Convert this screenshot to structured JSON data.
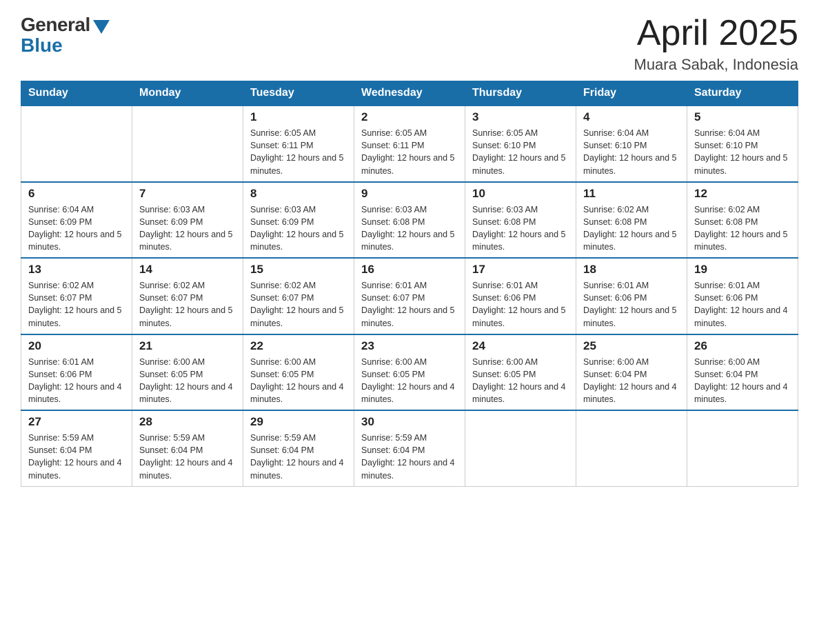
{
  "header": {
    "logo_general": "General",
    "logo_blue": "Blue",
    "title": "April 2025",
    "subtitle": "Muara Sabak, Indonesia"
  },
  "days_of_week": [
    "Sunday",
    "Monday",
    "Tuesday",
    "Wednesday",
    "Thursday",
    "Friday",
    "Saturday"
  ],
  "weeks": [
    [
      {
        "day": "",
        "info": ""
      },
      {
        "day": "",
        "info": ""
      },
      {
        "day": "1",
        "info": "Sunrise: 6:05 AM\nSunset: 6:11 PM\nDaylight: 12 hours and 5 minutes."
      },
      {
        "day": "2",
        "info": "Sunrise: 6:05 AM\nSunset: 6:11 PM\nDaylight: 12 hours and 5 minutes."
      },
      {
        "day": "3",
        "info": "Sunrise: 6:05 AM\nSunset: 6:10 PM\nDaylight: 12 hours and 5 minutes."
      },
      {
        "day": "4",
        "info": "Sunrise: 6:04 AM\nSunset: 6:10 PM\nDaylight: 12 hours and 5 minutes."
      },
      {
        "day": "5",
        "info": "Sunrise: 6:04 AM\nSunset: 6:10 PM\nDaylight: 12 hours and 5 minutes."
      }
    ],
    [
      {
        "day": "6",
        "info": "Sunrise: 6:04 AM\nSunset: 6:09 PM\nDaylight: 12 hours and 5 minutes."
      },
      {
        "day": "7",
        "info": "Sunrise: 6:03 AM\nSunset: 6:09 PM\nDaylight: 12 hours and 5 minutes."
      },
      {
        "day": "8",
        "info": "Sunrise: 6:03 AM\nSunset: 6:09 PM\nDaylight: 12 hours and 5 minutes."
      },
      {
        "day": "9",
        "info": "Sunrise: 6:03 AM\nSunset: 6:08 PM\nDaylight: 12 hours and 5 minutes."
      },
      {
        "day": "10",
        "info": "Sunrise: 6:03 AM\nSunset: 6:08 PM\nDaylight: 12 hours and 5 minutes."
      },
      {
        "day": "11",
        "info": "Sunrise: 6:02 AM\nSunset: 6:08 PM\nDaylight: 12 hours and 5 minutes."
      },
      {
        "day": "12",
        "info": "Sunrise: 6:02 AM\nSunset: 6:08 PM\nDaylight: 12 hours and 5 minutes."
      }
    ],
    [
      {
        "day": "13",
        "info": "Sunrise: 6:02 AM\nSunset: 6:07 PM\nDaylight: 12 hours and 5 minutes."
      },
      {
        "day": "14",
        "info": "Sunrise: 6:02 AM\nSunset: 6:07 PM\nDaylight: 12 hours and 5 minutes."
      },
      {
        "day": "15",
        "info": "Sunrise: 6:02 AM\nSunset: 6:07 PM\nDaylight: 12 hours and 5 minutes."
      },
      {
        "day": "16",
        "info": "Sunrise: 6:01 AM\nSunset: 6:07 PM\nDaylight: 12 hours and 5 minutes."
      },
      {
        "day": "17",
        "info": "Sunrise: 6:01 AM\nSunset: 6:06 PM\nDaylight: 12 hours and 5 minutes."
      },
      {
        "day": "18",
        "info": "Sunrise: 6:01 AM\nSunset: 6:06 PM\nDaylight: 12 hours and 5 minutes."
      },
      {
        "day": "19",
        "info": "Sunrise: 6:01 AM\nSunset: 6:06 PM\nDaylight: 12 hours and 4 minutes."
      }
    ],
    [
      {
        "day": "20",
        "info": "Sunrise: 6:01 AM\nSunset: 6:06 PM\nDaylight: 12 hours and 4 minutes."
      },
      {
        "day": "21",
        "info": "Sunrise: 6:00 AM\nSunset: 6:05 PM\nDaylight: 12 hours and 4 minutes."
      },
      {
        "day": "22",
        "info": "Sunrise: 6:00 AM\nSunset: 6:05 PM\nDaylight: 12 hours and 4 minutes."
      },
      {
        "day": "23",
        "info": "Sunrise: 6:00 AM\nSunset: 6:05 PM\nDaylight: 12 hours and 4 minutes."
      },
      {
        "day": "24",
        "info": "Sunrise: 6:00 AM\nSunset: 6:05 PM\nDaylight: 12 hours and 4 minutes."
      },
      {
        "day": "25",
        "info": "Sunrise: 6:00 AM\nSunset: 6:04 PM\nDaylight: 12 hours and 4 minutes."
      },
      {
        "day": "26",
        "info": "Sunrise: 6:00 AM\nSunset: 6:04 PM\nDaylight: 12 hours and 4 minutes."
      }
    ],
    [
      {
        "day": "27",
        "info": "Sunrise: 5:59 AM\nSunset: 6:04 PM\nDaylight: 12 hours and 4 minutes."
      },
      {
        "day": "28",
        "info": "Sunrise: 5:59 AM\nSunset: 6:04 PM\nDaylight: 12 hours and 4 minutes."
      },
      {
        "day": "29",
        "info": "Sunrise: 5:59 AM\nSunset: 6:04 PM\nDaylight: 12 hours and 4 minutes."
      },
      {
        "day": "30",
        "info": "Sunrise: 5:59 AM\nSunset: 6:04 PM\nDaylight: 12 hours and 4 minutes."
      },
      {
        "day": "",
        "info": ""
      },
      {
        "day": "",
        "info": ""
      },
      {
        "day": "",
        "info": ""
      }
    ]
  ]
}
